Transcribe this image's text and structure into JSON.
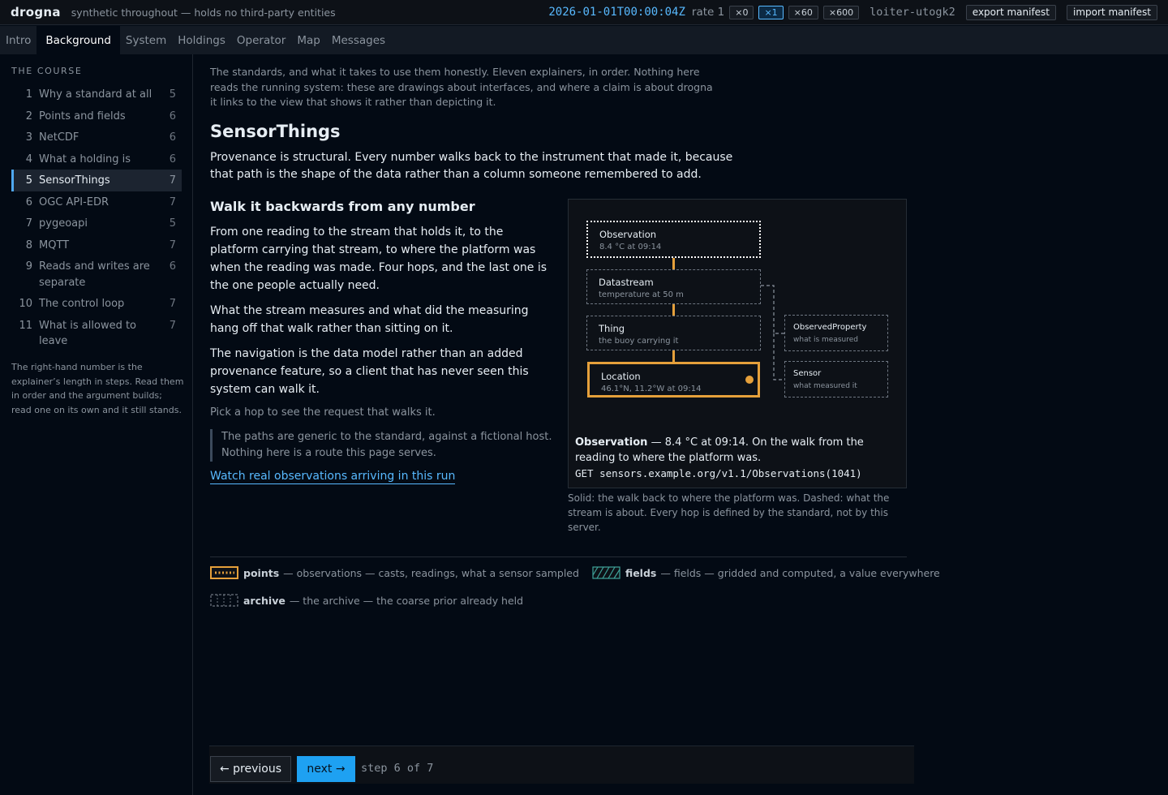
{
  "topbar": {
    "brand": "drogna",
    "tagline": "synthetic throughout — holds no third-party entities",
    "clock": "2026-01-01T00:00:04Z",
    "rate_label": "rate 1",
    "rates": [
      "×0",
      "×1",
      "×60",
      "×600"
    ],
    "active_rate": "×1",
    "session": "loiter-utogk2",
    "export_label": "export manifest",
    "import_label": "import manifest"
  },
  "tabs": [
    "Intro",
    "Background",
    "System",
    "Holdings",
    "Operator",
    "Map",
    "Messages"
  ],
  "active_tab": "Background",
  "sidebar": {
    "heading": "THE COURSE",
    "items": [
      {
        "num": "1",
        "label": "Why a standard at all",
        "steps": "5"
      },
      {
        "num": "2",
        "label": "Points and fields",
        "steps": "6"
      },
      {
        "num": "3",
        "label": "NetCDF",
        "steps": "6"
      },
      {
        "num": "4",
        "label": "What a holding is",
        "steps": "6"
      },
      {
        "num": "5",
        "label": "SensorThings",
        "steps": "7"
      },
      {
        "num": "6",
        "label": "OGC API-EDR",
        "steps": "7"
      },
      {
        "num": "7",
        "label": "pygeoapi",
        "steps": "5"
      },
      {
        "num": "8",
        "label": "MQTT",
        "steps": "7"
      },
      {
        "num": "9",
        "label": "Reads and writes are separate",
        "steps": "6"
      },
      {
        "num": "10",
        "label": "The control loop",
        "steps": "7"
      },
      {
        "num": "11",
        "label": "What is allowed to leave",
        "steps": "7"
      }
    ],
    "active_item": "5",
    "note": "The right-hand number is the explainer’s length in steps. Read them in order and the argument builds; read one on its own and it still stands."
  },
  "main": {
    "intro": "The standards, and what it takes to use them honestly. Eleven explainers, in order. Nothing here reads the running system: these are drawings about interfaces, and where a claim is about drogna it links to the view that shows it rather than depicting it.",
    "title": "SensorThings",
    "lead": "Provenance is structural. Every number walks back to the instrument that made it, because that path is the shape of the data rather than a column someone remembered to add.",
    "subtitle": "Walk it backwards from any number",
    "paragraphs": [
      "From one reading to the stream that holds it, to the platform carrying that stream, to where the platform was when the reading was made. Four hops, and the last one is the one people actually need.",
      "What the stream measures and what did the measuring hang off that walk rather than sitting on it.",
      "The navigation is the data model rather than an added provenance feature, so a client that has never seen this system can walk it."
    ],
    "pick_hint": "Pick a hop to see the request that walks it.",
    "quote": "The paths are generic to the standard, against a fictional host. Nothing here is a route this page serves.",
    "link": "Watch real observations arriving in this run"
  },
  "diagram": {
    "nodes": {
      "observation": {
        "title": "Observation",
        "sub": "8.4 °C at 09:14"
      },
      "datastream": {
        "title": "Datastream",
        "sub": "temperature at 50 m"
      },
      "thing": {
        "title": "Thing",
        "sub": "the buoy carrying it"
      },
      "location": {
        "title": "Location",
        "sub": "46.1°N, 11.2°W at 09:14"
      },
      "observed_property": {
        "title": "ObservedProperty",
        "sub": "what is measured"
      },
      "sensor": {
        "title": "Sensor",
        "sub": "what measured it"
      }
    },
    "detail": {
      "name": "Observation",
      "text": " — 8.4 °C at 09:14. On the walk from the reading to where the platform was.",
      "request": "GET sensors.example.org/v1.1/Observations(1041)"
    },
    "caption": "Solid: the walk back to where the platform was. Dashed: what the stream is about. Every hop is defined by the standard, not by this server.",
    "colors": {
      "walk": "#e5a03b",
      "dashed": "#6e7681",
      "selected": "#ffffff"
    }
  },
  "legend": [
    {
      "key": "points",
      "text": "— observations — casts, readings, what a sensor sampled"
    },
    {
      "key": "fields",
      "text": "— fields — gridded and computed, a value everywhere"
    },
    {
      "key": "archive",
      "text": "— the archive — the coarse prior already held"
    }
  ],
  "footer": {
    "prev": "← previous",
    "next": "next →",
    "step": "step 6 of 7"
  },
  "colors": {
    "accent": "#58b9ff",
    "walk": "#e5a03b",
    "fields": "#3fa39a",
    "background": "#030a14"
  }
}
